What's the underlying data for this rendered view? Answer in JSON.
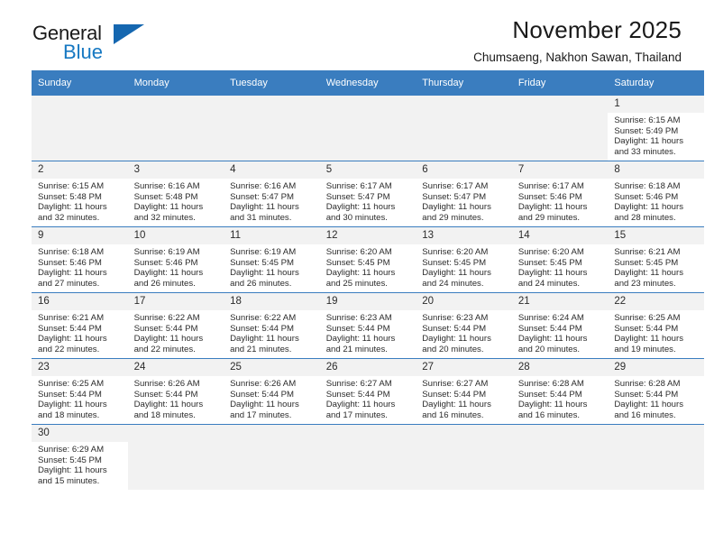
{
  "brand": {
    "name_top": "General",
    "name_bottom": "Blue",
    "accent_color": "#1678c2",
    "flag_color": "#1567b0"
  },
  "header": {
    "title": "November 2025",
    "subtitle": "Chumsaeng, Nakhon Sawan, Thailand"
  },
  "calendar": {
    "header_bg": "#3a7dbf",
    "weekday_headers": [
      "Sunday",
      "Monday",
      "Tuesday",
      "Wednesday",
      "Thursday",
      "Friday",
      "Saturday"
    ],
    "labels": {
      "sunrise": "Sunrise:",
      "sunset": "Sunset:",
      "daylight": "Daylight:"
    },
    "weeks": [
      [
        null,
        null,
        null,
        null,
        null,
        null,
        {
          "day": "1",
          "sunrise": "Sunrise: 6:15 AM",
          "sunset": "Sunset: 5:49 PM",
          "daylight": "Daylight: 11 hours and 33 minutes."
        }
      ],
      [
        {
          "day": "2",
          "sunrise": "Sunrise: 6:15 AM",
          "sunset": "Sunset: 5:48 PM",
          "daylight": "Daylight: 11 hours and 32 minutes."
        },
        {
          "day": "3",
          "sunrise": "Sunrise: 6:16 AM",
          "sunset": "Sunset: 5:48 PM",
          "daylight": "Daylight: 11 hours and 32 minutes."
        },
        {
          "day": "4",
          "sunrise": "Sunrise: 6:16 AM",
          "sunset": "Sunset: 5:47 PM",
          "daylight": "Daylight: 11 hours and 31 minutes."
        },
        {
          "day": "5",
          "sunrise": "Sunrise: 6:17 AM",
          "sunset": "Sunset: 5:47 PM",
          "daylight": "Daylight: 11 hours and 30 minutes."
        },
        {
          "day": "6",
          "sunrise": "Sunrise: 6:17 AM",
          "sunset": "Sunset: 5:47 PM",
          "daylight": "Daylight: 11 hours and 29 minutes."
        },
        {
          "day": "7",
          "sunrise": "Sunrise: 6:17 AM",
          "sunset": "Sunset: 5:46 PM",
          "daylight": "Daylight: 11 hours and 29 minutes."
        },
        {
          "day": "8",
          "sunrise": "Sunrise: 6:18 AM",
          "sunset": "Sunset: 5:46 PM",
          "daylight": "Daylight: 11 hours and 28 minutes."
        }
      ],
      [
        {
          "day": "9",
          "sunrise": "Sunrise: 6:18 AM",
          "sunset": "Sunset: 5:46 PM",
          "daylight": "Daylight: 11 hours and 27 minutes."
        },
        {
          "day": "10",
          "sunrise": "Sunrise: 6:19 AM",
          "sunset": "Sunset: 5:46 PM",
          "daylight": "Daylight: 11 hours and 26 minutes."
        },
        {
          "day": "11",
          "sunrise": "Sunrise: 6:19 AM",
          "sunset": "Sunset: 5:45 PM",
          "daylight": "Daylight: 11 hours and 26 minutes."
        },
        {
          "day": "12",
          "sunrise": "Sunrise: 6:20 AM",
          "sunset": "Sunset: 5:45 PM",
          "daylight": "Daylight: 11 hours and 25 minutes."
        },
        {
          "day": "13",
          "sunrise": "Sunrise: 6:20 AM",
          "sunset": "Sunset: 5:45 PM",
          "daylight": "Daylight: 11 hours and 24 minutes."
        },
        {
          "day": "14",
          "sunrise": "Sunrise: 6:20 AM",
          "sunset": "Sunset: 5:45 PM",
          "daylight": "Daylight: 11 hours and 24 minutes."
        },
        {
          "day": "15",
          "sunrise": "Sunrise: 6:21 AM",
          "sunset": "Sunset: 5:45 PM",
          "daylight": "Daylight: 11 hours and 23 minutes."
        }
      ],
      [
        {
          "day": "16",
          "sunrise": "Sunrise: 6:21 AM",
          "sunset": "Sunset: 5:44 PM",
          "daylight": "Daylight: 11 hours and 22 minutes."
        },
        {
          "day": "17",
          "sunrise": "Sunrise: 6:22 AM",
          "sunset": "Sunset: 5:44 PM",
          "daylight": "Daylight: 11 hours and 22 minutes."
        },
        {
          "day": "18",
          "sunrise": "Sunrise: 6:22 AM",
          "sunset": "Sunset: 5:44 PM",
          "daylight": "Daylight: 11 hours and 21 minutes."
        },
        {
          "day": "19",
          "sunrise": "Sunrise: 6:23 AM",
          "sunset": "Sunset: 5:44 PM",
          "daylight": "Daylight: 11 hours and 21 minutes."
        },
        {
          "day": "20",
          "sunrise": "Sunrise: 6:23 AM",
          "sunset": "Sunset: 5:44 PM",
          "daylight": "Daylight: 11 hours and 20 minutes."
        },
        {
          "day": "21",
          "sunrise": "Sunrise: 6:24 AM",
          "sunset": "Sunset: 5:44 PM",
          "daylight": "Daylight: 11 hours and 20 minutes."
        },
        {
          "day": "22",
          "sunrise": "Sunrise: 6:25 AM",
          "sunset": "Sunset: 5:44 PM",
          "daylight": "Daylight: 11 hours and 19 minutes."
        }
      ],
      [
        {
          "day": "23",
          "sunrise": "Sunrise: 6:25 AM",
          "sunset": "Sunset: 5:44 PM",
          "daylight": "Daylight: 11 hours and 18 minutes."
        },
        {
          "day": "24",
          "sunrise": "Sunrise: 6:26 AM",
          "sunset": "Sunset: 5:44 PM",
          "daylight": "Daylight: 11 hours and 18 minutes."
        },
        {
          "day": "25",
          "sunrise": "Sunrise: 6:26 AM",
          "sunset": "Sunset: 5:44 PM",
          "daylight": "Daylight: 11 hours and 17 minutes."
        },
        {
          "day": "26",
          "sunrise": "Sunrise: 6:27 AM",
          "sunset": "Sunset: 5:44 PM",
          "daylight": "Daylight: 11 hours and 17 minutes."
        },
        {
          "day": "27",
          "sunrise": "Sunrise: 6:27 AM",
          "sunset": "Sunset: 5:44 PM",
          "daylight": "Daylight: 11 hours and 16 minutes."
        },
        {
          "day": "28",
          "sunrise": "Sunrise: 6:28 AM",
          "sunset": "Sunset: 5:44 PM",
          "daylight": "Daylight: 11 hours and 16 minutes."
        },
        {
          "day": "29",
          "sunrise": "Sunrise: 6:28 AM",
          "sunset": "Sunset: 5:44 PM",
          "daylight": "Daylight: 11 hours and 16 minutes."
        }
      ],
      [
        {
          "day": "30",
          "sunrise": "Sunrise: 6:29 AM",
          "sunset": "Sunset: 5:45 PM",
          "daylight": "Daylight: 11 hours and 15 minutes."
        },
        null,
        null,
        null,
        null,
        null,
        null
      ]
    ]
  }
}
